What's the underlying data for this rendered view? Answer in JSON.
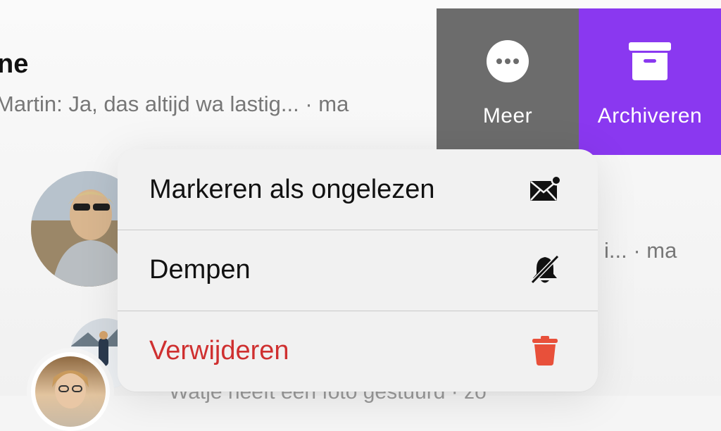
{
  "chat_list": {
    "row1": {
      "title_fragment": "ne",
      "preview": "Martin: Ja, das altijd wa lastig...  · ma"
    },
    "row2": {
      "preview_fragment": "i...  · ma"
    },
    "row3": {
      "preview_fragment": "Watje heeft een foto gestuurd · zo"
    }
  },
  "swipe_actions": {
    "more": {
      "label": "Meer",
      "icon": "ellipsis-circle-icon",
      "color": "#6c6c6c"
    },
    "archive": {
      "label": "Archiveren",
      "icon": "archive-box-icon",
      "color": "#8a38f0"
    }
  },
  "context_menu": {
    "items": [
      {
        "label": "Markeren als ongelezen",
        "icon": "envelope-unread-icon"
      },
      {
        "label": "Dempen",
        "icon": "bell-slash-icon"
      },
      {
        "label": "Verwijderen",
        "icon": "trash-icon",
        "color": "#cf3030"
      }
    ]
  }
}
